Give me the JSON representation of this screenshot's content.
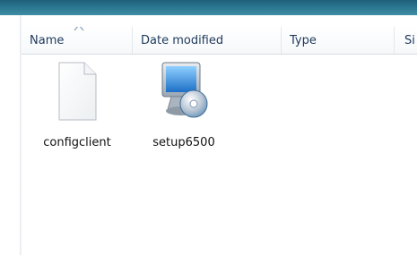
{
  "columns": [
    {
      "label": "Name",
      "sorted": "ascending"
    },
    {
      "label": "Date modified"
    },
    {
      "label": "Type"
    },
    {
      "label": "Si"
    }
  ],
  "files": [
    {
      "name": "configclient",
      "icon": "blank-document-icon"
    },
    {
      "name": "setup6500",
      "icon": "setup-installer-icon"
    }
  ],
  "colors": {
    "title_strip": "#2a7590",
    "header_text": "#1e395b",
    "monitor_screen": "#2f8fe0"
  }
}
